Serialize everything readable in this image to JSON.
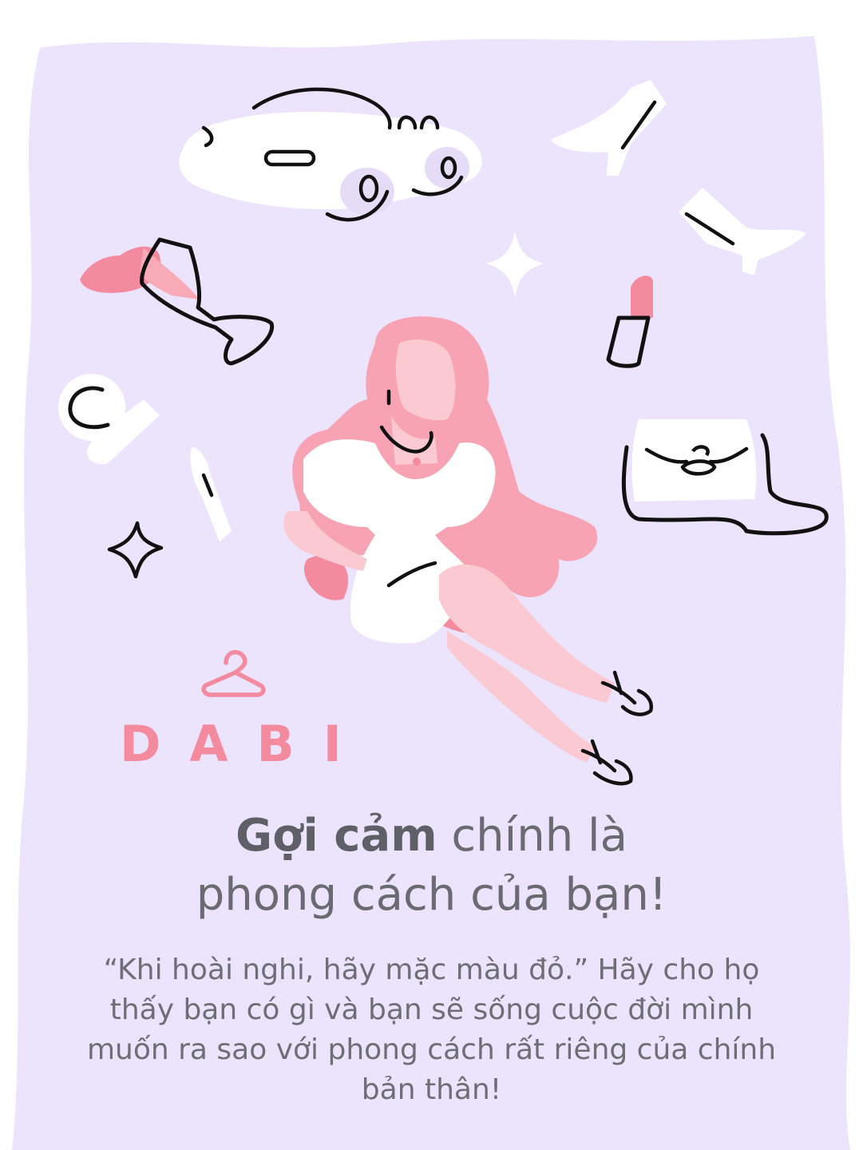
{
  "brand": {
    "name": "DABI",
    "accent_color": "#f48a9e",
    "icon": "hanger-icon"
  },
  "headline": {
    "bold": "Gợi cảm",
    "line1_rest": " chính là",
    "line2": "phong cách của bạn!"
  },
  "body": {
    "text": "“Khi hoài nghi, hãy mặc màu đỏ.” Hãy cho họ thấy bạn có gì và bạn sẽ sống cuộc đời mình muốn ra sao với phong cách rất riêng của chính bản thân!"
  },
  "colors": {
    "background_blob": "#ece3fc",
    "pink": "#f48a9e",
    "light_pink": "#fbc9d2",
    "outline": "#111111"
  },
  "illustration": {
    "icons": [
      "car-icon",
      "high-heel-icon",
      "wine-glass-icon",
      "sparkle-icon",
      "lipstick-icon",
      "perfume-icon",
      "handbag-icon",
      "woman-figure"
    ]
  }
}
